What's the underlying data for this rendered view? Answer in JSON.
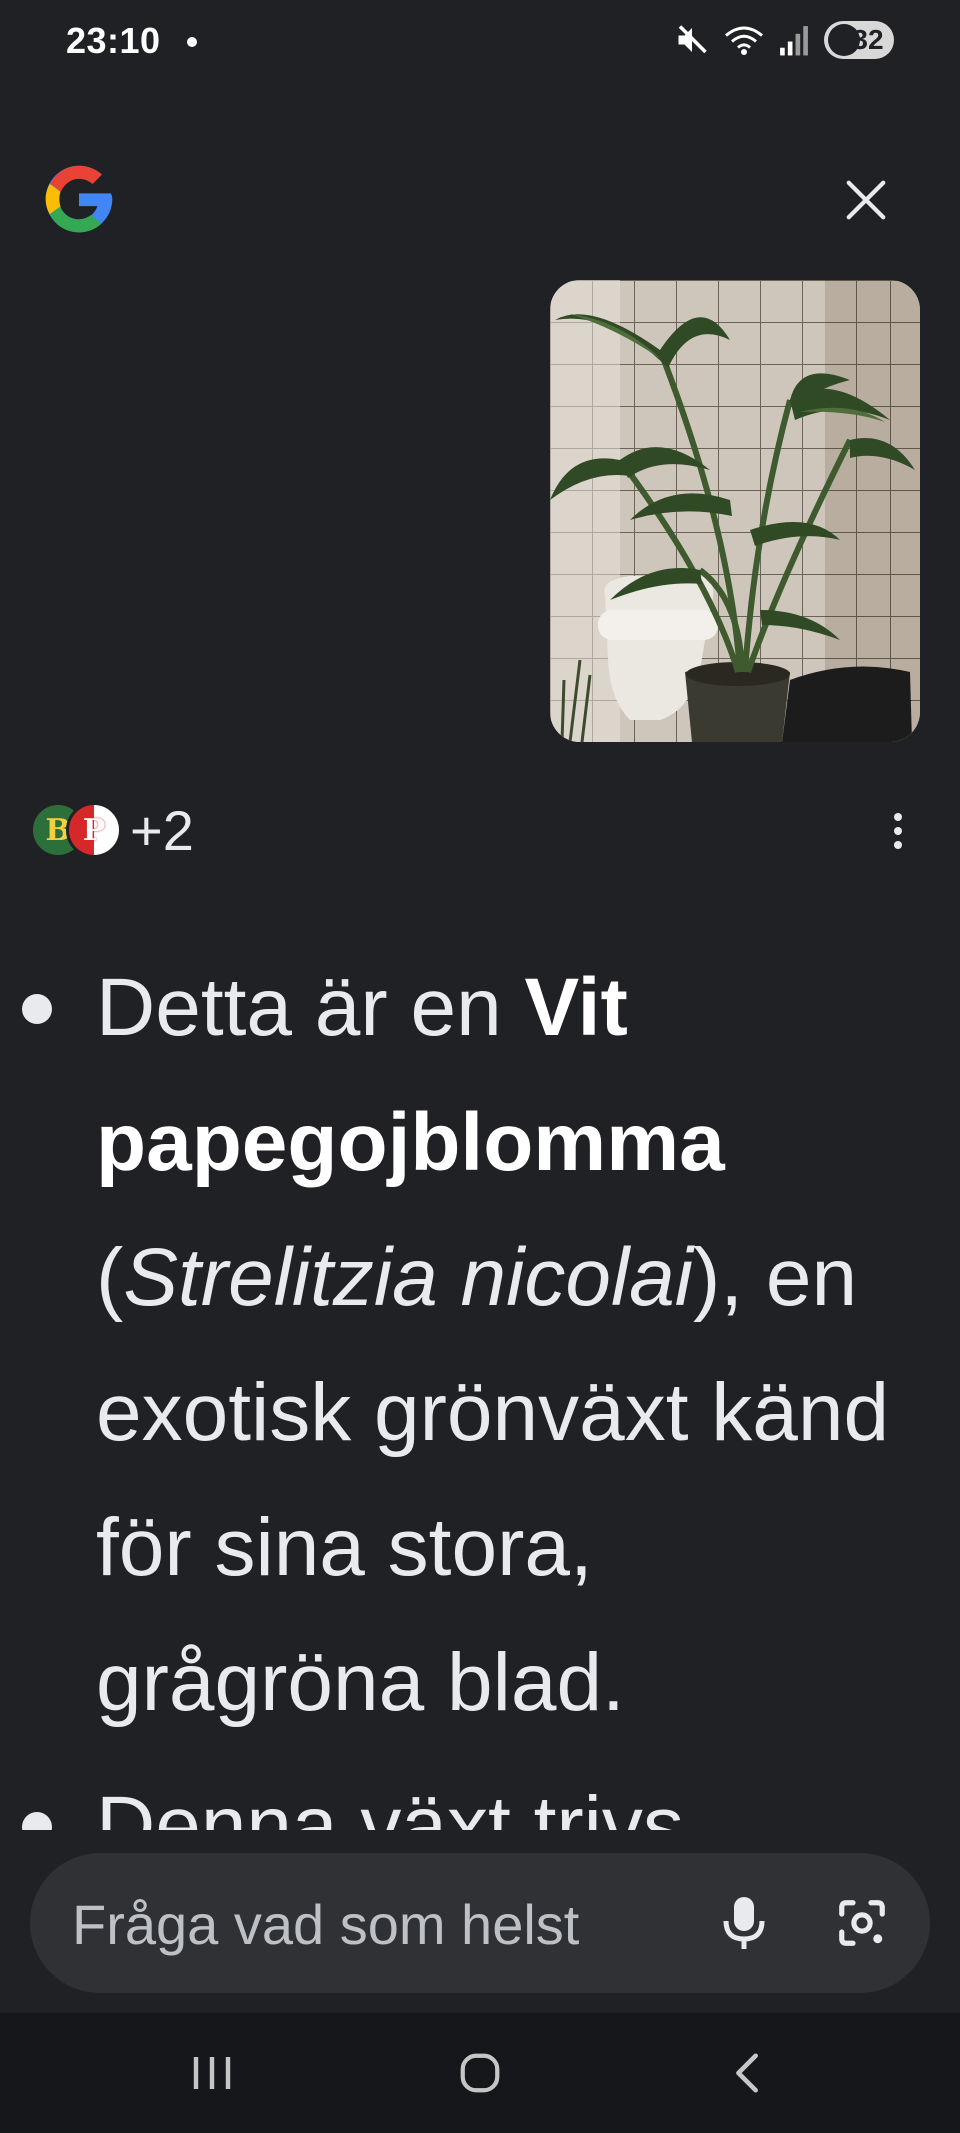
{
  "status_bar": {
    "time": "23:10",
    "battery": "32"
  },
  "answer": {
    "bullet1": {
      "part1": "Detta är en ",
      "bold": "Vit papegojblomma",
      "part2": " (",
      "italic": "Strelitzia nicolai",
      "part3": "), en exotisk grönväxt känd för sina stora, grågröna blad."
    },
    "bullet2": "Denna växt trivs"
  },
  "sources": {
    "badge_b": "B",
    "badge_p": "P",
    "more_count": "+2"
  },
  "ask": {
    "placeholder": "Fråga vad som helst"
  },
  "icons": {
    "logo": "google-g-icon",
    "close": "close-icon",
    "more": "more-vert-icon",
    "mic": "mic-icon",
    "lens": "google-lens-icon",
    "recents": "recents-icon",
    "home": "home-icon",
    "back": "back-icon"
  }
}
